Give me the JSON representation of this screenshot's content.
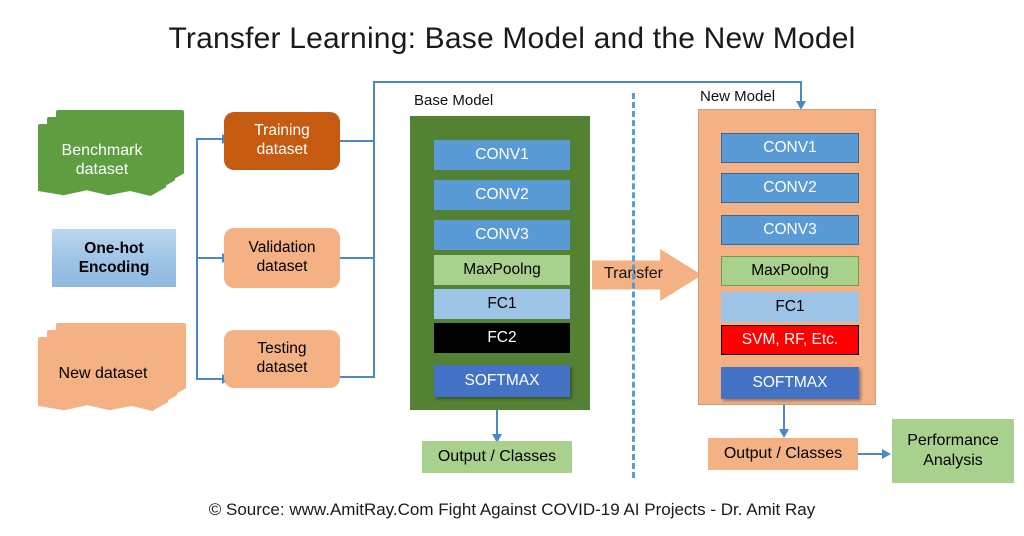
{
  "title": "Transfer Learning: Base Model and the New Model",
  "footer": "© Source: www.AmitRay.Com  Fight Against COVID-19 AI Projects  - Dr. Amit Ray",
  "sources": [
    {
      "label": "Benchmark dataset",
      "line1": "Benchmark",
      "line2": "dataset",
      "color": "#5E9E41",
      "text_color": "#ffffff"
    },
    {
      "label": "One-hot Encoding",
      "line1": "One-hot",
      "line2": "Encoding",
      "color": "#9DC3E6",
      "text_color": "#000000"
    },
    {
      "label": "New dataset",
      "line1": "New dataset",
      "line2": "",
      "color": "#F4B183",
      "text_color": "#000000"
    }
  ],
  "splits": [
    {
      "line1": "Training",
      "line2": "dataset",
      "color": "#C55A11",
      "text_color": "#ffffff"
    },
    {
      "line1": "Validation",
      "line2": "dataset",
      "color": "#F4B183",
      "text_color": "#000000"
    },
    {
      "line1": "Testing",
      "line2": "dataset",
      "color": "#F4B183",
      "text_color": "#000000"
    }
  ],
  "base_model": {
    "title": "Base Model",
    "panel_color": "#548235",
    "layers": [
      {
        "label": "CONV1",
        "fill": "#5B9BD5",
        "text_color": "#ffffff"
      },
      {
        "label": "CONV2",
        "fill": "#5B9BD5",
        "text_color": "#ffffff"
      },
      {
        "label": "CONV3",
        "fill": "#5B9BD5",
        "text_color": "#ffffff"
      },
      {
        "label": "MaxPoolng",
        "fill": "#A9D18E",
        "text_color": "#000000"
      },
      {
        "label": "FC1",
        "fill": "#9DC3E6",
        "text_color": "#000000"
      },
      {
        "label": "FC2",
        "fill": "#000000",
        "text_color": "#ffffff"
      },
      {
        "label": "SOFTMAX",
        "fill": "#4472C4",
        "text_color": "#ffffff"
      }
    ]
  },
  "new_model": {
    "title": "New Model",
    "panel_color": "#F4B183",
    "layers": [
      {
        "label": "CONV1",
        "fill": "#5B9BD5",
        "text_color": "#ffffff"
      },
      {
        "label": "CONV2",
        "fill": "#5B9BD5",
        "text_color": "#ffffff"
      },
      {
        "label": "CONV3",
        "fill": "#5B9BD5",
        "text_color": "#ffffff"
      },
      {
        "label": "MaxPoolng",
        "fill": "#A9D18E",
        "text_color": "#000000"
      },
      {
        "label": "FC1",
        "fill": "#9DC3E6",
        "text_color": "#000000"
      },
      {
        "label": "SVM, RF, Etc.",
        "fill": "#FF0000",
        "text_color": "#ffffff"
      },
      {
        "label": "SOFTMAX",
        "fill": "#4472C4",
        "text_color": "#ffffff"
      }
    ]
  },
  "transfer": {
    "label": "Transfer",
    "color": "#F4B183"
  },
  "outputs": {
    "base": {
      "label": "Output / Classes",
      "color": "#A9D18E",
      "text_color": "#000000"
    },
    "new": {
      "label": "Output / Classes",
      "color": "#F4B183",
      "text_color": "#000000"
    }
  },
  "performance": {
    "line1": "Performance",
    "line2": "Analysis",
    "color": "#A9D18E",
    "text_color": "#000000"
  },
  "colors": {
    "connector": "#4E87C7",
    "divider": "#5B9BD5",
    "background": "#ffffff"
  }
}
